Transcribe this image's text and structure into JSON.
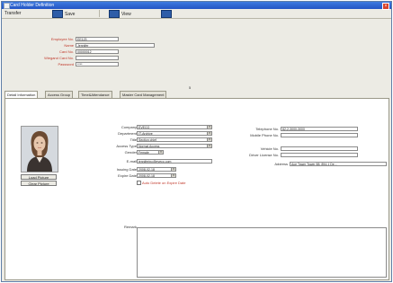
{
  "window": {
    "title": "Card Holder Definition"
  },
  "toolbar": {
    "transfer_label": "Transfer",
    "save_label": "Save",
    "view_label": "View"
  },
  "top_form": {
    "employee_no_label": "Employee No.",
    "employee_no_value": "EE123",
    "name_label": "Name",
    "name_value": "Jennifer",
    "card_no_label": "Card No.",
    "card_no_value": "00000012",
    "wiegand_card_no_label": "Wiegand Card No.",
    "wiegand_card_no_value": "",
    "password_label": "Password",
    "password_value": "****"
  },
  "page_indicator": "5",
  "tabs": [
    {
      "label": "Detail Information"
    },
    {
      "label": "Access Group"
    },
    {
      "label": "Time&Attendance"
    },
    {
      "label": "Master Card Management"
    }
  ],
  "photo": {
    "load_label": "Load Picture",
    "clear_label": "Clear Picture"
  },
  "details": {
    "company_label": "Company",
    "company_value": "EVECO",
    "department_label": "Department",
    "department_value": "IT-Archive",
    "title_label": "Title",
    "title_value": "Section chief",
    "access_type_label": "Access Type",
    "access_type_value": "Normal Access",
    "gender_label": "Gender",
    "gender_value": "Female",
    "email_label": "E-mail",
    "email_value": "jenniferinc@eveco.com",
    "issuing_date_label": "Issuing Date",
    "issuing_date_value": "2008-02-18",
    "expire_date_label": "Expire Date",
    "expire_date_value": "2008-02-18",
    "auto_delete_label": "Auto Delete on Expire Date",
    "remark_label": "Remark",
    "remark_value": ""
  },
  "contact": {
    "telephone_label": "Telephone No.",
    "telephone_value": "82-2-3000-3000",
    "mobile_label": "Mobile Phone No.",
    "mobile_value": "",
    "vehicle_label": "Vehicle No.",
    "vehicle_value": "",
    "driver_license_label": "Driver License No.",
    "driver_license_value": "",
    "address_label": "Address",
    "address_value": "Ace Tower Tower 88, 894-1 De..."
  }
}
